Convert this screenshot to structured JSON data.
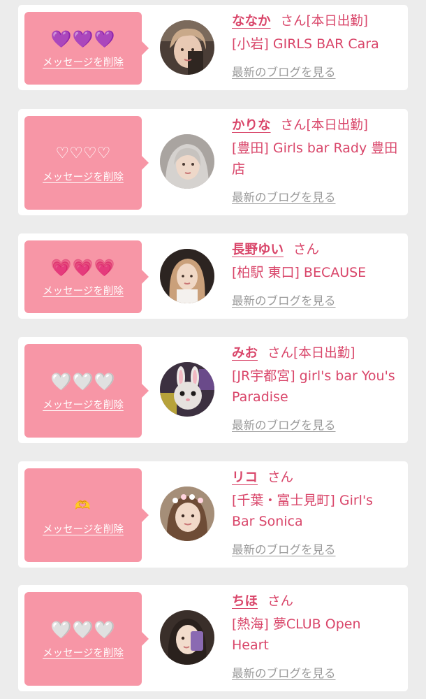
{
  "colors": {
    "accent": "#d9466a",
    "bubble": "#f796a6",
    "blog_link": "#9a9a9a",
    "background": "#ececec"
  },
  "cards": [
    {
      "emoji": "💜💜💜",
      "emoji_style": "purple-hearts",
      "delete_label": "メッセージを削除",
      "name": "ななか",
      "suffix": "さん",
      "status": "[本日出勤]",
      "shop": "[小岩] GIRLS BAR Cara",
      "blog_label": "最新のブログを見る",
      "avatar_icon": "girl-photo"
    },
    {
      "emoji": "♡♡♡♡",
      "emoji_style": "outline-hearts",
      "delete_label": "メッセージを削除",
      "name": "かりな",
      "suffix": "さん",
      "status": "[本日出勤]",
      "shop": "[豊田] Girls bar Rady 豊田店",
      "blog_label": "最新のブログを見る",
      "avatar_icon": "girl-photo"
    },
    {
      "emoji": "💗💗💗",
      "emoji_style": "pink-hearts",
      "delete_label": "メッセージを削除",
      "name": "長野ゆい",
      "suffix": "さん",
      "status": "",
      "shop": "[柏駅 東口] BECAUSE",
      "blog_label": "最新のブログを見る",
      "avatar_icon": "girl-photo"
    },
    {
      "emoji": "🤍🤍🤍",
      "emoji_style": "white-hearts",
      "delete_label": "メッセージを削除",
      "name": "みお",
      "suffix": "さん",
      "status": "[本日出勤]",
      "shop": "[JR宇都宮] girl's bar You's Paradise",
      "blog_label": "最新のブログを見る",
      "avatar_icon": "bunny-face-photo"
    },
    {
      "emoji": "🫶",
      "emoji_style": "heart-hands",
      "delete_label": "メッセージを削除",
      "name": "リコ",
      "suffix": "さん",
      "status": "",
      "shop": "[千葉・富士見町] Girl's Bar Sonica",
      "blog_label": "最新のブログを見る",
      "avatar_icon": "girl-photo"
    },
    {
      "emoji": "🤍🤍🤍",
      "emoji_style": "white-hearts",
      "delete_label": "メッセージを削除",
      "name": "ちほ",
      "suffix": "さん",
      "status": "",
      "shop": "[熱海] 夢CLUB Open Heart",
      "blog_label": "最新のブログを見る",
      "avatar_icon": "girl-photo"
    }
  ]
}
